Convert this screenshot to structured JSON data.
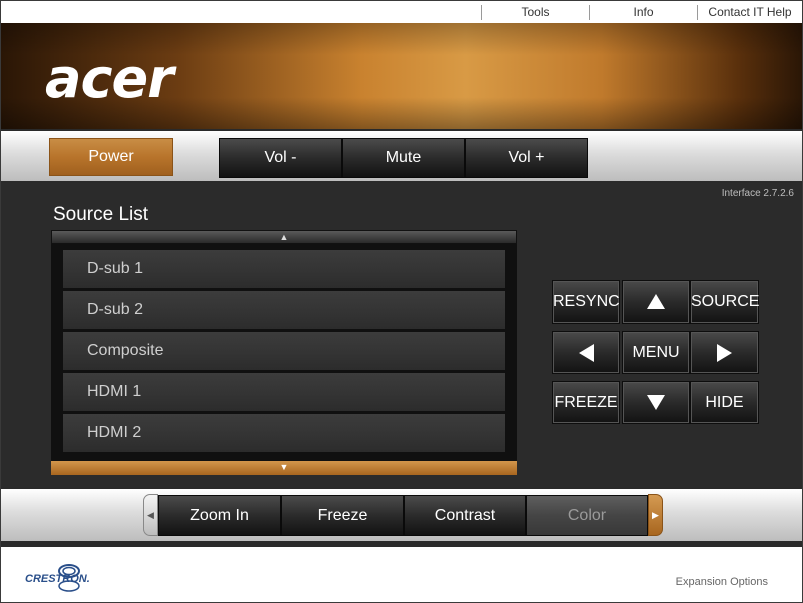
{
  "top_menu": {
    "tools": "Tools",
    "info": "Info",
    "help": "Contact IT Help"
  },
  "brand": {
    "logo": "acer"
  },
  "controls": {
    "power": "Power",
    "vol_down": "Vol -",
    "mute": "Mute",
    "vol_up": "Vol +"
  },
  "version": "Interface 2.7.2.6",
  "source_list": {
    "title": "Source List",
    "items": [
      "D-sub 1",
      "D-sub 2",
      "Composite",
      "HDMI 1",
      "HDMI 2"
    ]
  },
  "nav_pad": {
    "resync": "RESYNC",
    "source": "SOURCE",
    "menu": "MENU",
    "freeze": "FREEZE",
    "hide": "HIDE"
  },
  "bottom_bar": {
    "zoom_in": "Zoom In",
    "freeze": "Freeze",
    "contrast": "Contrast",
    "color": "Color"
  },
  "footer": {
    "crestron": "CRESTRON.",
    "expansion": "Expansion Options"
  },
  "colors": {
    "accent": "#b8742b",
    "background": "#2b2b2b"
  }
}
